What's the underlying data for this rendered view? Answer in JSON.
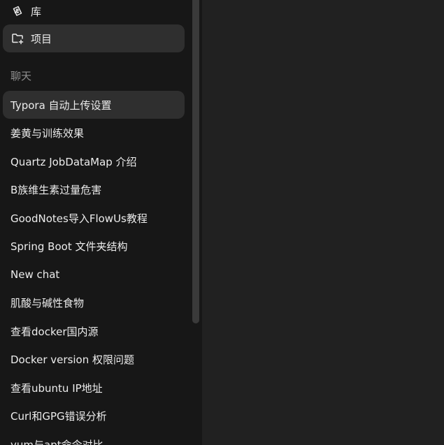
{
  "sidebar": {
    "nav": {
      "library": {
        "label": "库",
        "icon": "library-icon"
      },
      "projects": {
        "label": "项目",
        "icon": "folder-plus-icon"
      }
    },
    "section_label": "聊天",
    "chats": [
      "Typora 自动上传设置",
      "姜黄与训练效果",
      "Quartz JobDataMap 介绍",
      "B族维生素过量危害",
      "GoodNotes导入FlowUs教程",
      "Spring Boot 文件夹结构",
      "New chat",
      "肌酸与碱性食物",
      "查看docker国内源",
      "Docker version 权限问题",
      "查看ubuntu IP地址",
      "Curl和GPG错误分析",
      "yum与apt命令对比"
    ]
  },
  "colors": {
    "sidebar_bg": "#171717",
    "main_bg": "#212121",
    "active_item_bg": "#2f2f2f",
    "text": "#ececec",
    "muted_text": "#8f8f8f"
  }
}
